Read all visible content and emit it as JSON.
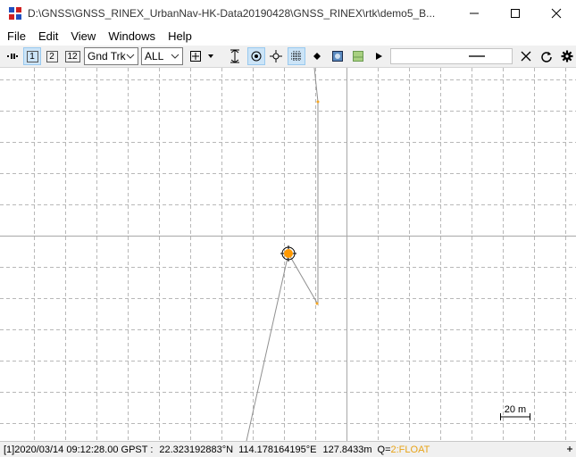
{
  "window": {
    "title": "D:\\GNSS\\GNSS_RINEX_UrbanNav-HK-Data20190428\\GNSS_RINEX\\rtk\\demo5_B...",
    "minimize_icon": "minimize-icon",
    "maximize_icon": "maximize-icon",
    "close_icon": "close-icon"
  },
  "menu": {
    "items": [
      "File",
      "Edit",
      "View",
      "Windows",
      "Help"
    ]
  },
  "toolbar": {
    "buttons": [
      "1",
      "2",
      "12"
    ],
    "plot_type": "Gnd Trk",
    "satellite_filter": "ALL"
  },
  "plot": {
    "scale_label": "20 m",
    "colors": {
      "grid": "#b8b8b8",
      "track": "#909090",
      "float_point": "#f5a623",
      "marker": "#ff9900"
    }
  },
  "status": {
    "index": "[1]",
    "datetime": "2020/03/14 09:12:28.00 GPST :",
    "latitude": "22.323192883°N",
    "longitude": "114.178164195°E",
    "height": "127.8433m",
    "q_label": "Q=",
    "q_value": "2:FLOAT"
  }
}
